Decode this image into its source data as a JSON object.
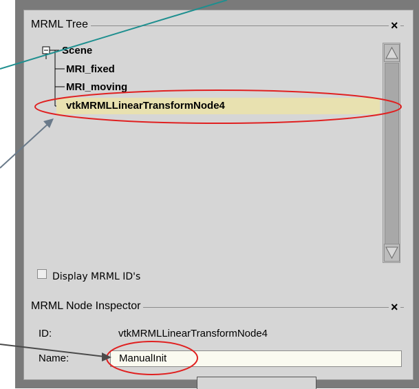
{
  "tree_group": {
    "title": "MRML Tree",
    "close": "×",
    "items": [
      {
        "label": "Scene"
      },
      {
        "label": "MRI_fixed"
      },
      {
        "label": "MRI_moving"
      },
      {
        "label": "vtkMRMLLinearTransformNode4"
      }
    ],
    "display_ids_label": "Display MRML ID's"
  },
  "inspector_group": {
    "title": "MRML Node Inspector",
    "close": "×",
    "id_label": "ID:",
    "id_value": "vtkMRMLLinearTransformNode4",
    "name_label": "Name:",
    "name_value": "ManualInit"
  },
  "colors": {
    "highlight_fill": "#e8e1b0",
    "annotation_red": "#e02020",
    "arrow_gray": "#6a7a8a",
    "arrow_teal": "#1e8f8f"
  }
}
